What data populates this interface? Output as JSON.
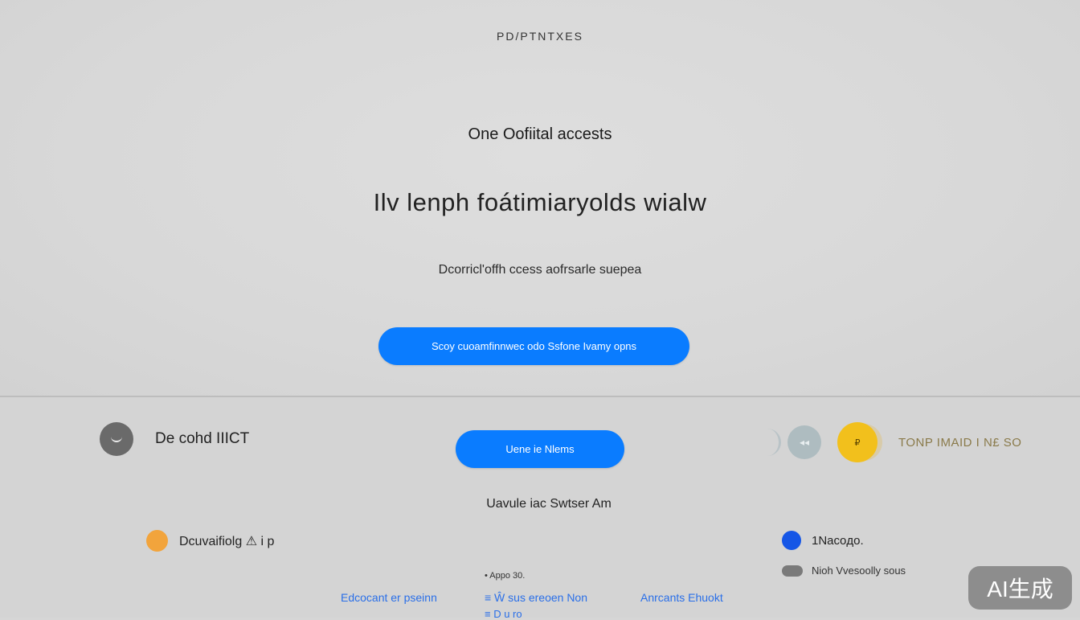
{
  "header": {
    "brand": "PD/PTNTXES"
  },
  "hero": {
    "eyebrow": "One Oofiital accests",
    "headline": "Ilv lenph foátimiaryolds wialw",
    "subhead": "Dcorricl'offh ccess aofrsarle suepea",
    "cta_label": "Scoy cuoamfinnwec odo Ssfone Ivamy opns"
  },
  "bottom": {
    "left_profile_label": "De cohd IIICT",
    "center_button_label": "Uene ie Nlems",
    "right_label": "TONP IMAID I N£ SO",
    "right_icon_text": "◂◂",
    "yellow_icon_text": "₽",
    "center_caption": "Uavule iac Swtser Am",
    "left_item_label": "Dcuvaifiolg ⚠ i p",
    "right_item_label": "1Nacoдo.",
    "right_subitem_label": "Nioh Vvesoolly sous",
    "small_note": "• Appo 30.",
    "links": {
      "left": "Edcocant er pseinn",
      "middle": "≡ Ŵ sus ereoen Non",
      "right": "Anrcants  Ehuokt",
      "bottom": "≡ D u ro"
    }
  },
  "watermark": "AI生成",
  "colors": {
    "accent": "#0a7cff",
    "background": "#d6d6d6",
    "link": "#2a6fe8",
    "orange": "#f2a43c",
    "yellow": "#f2c01c",
    "blue_dot": "#1556e6"
  }
}
